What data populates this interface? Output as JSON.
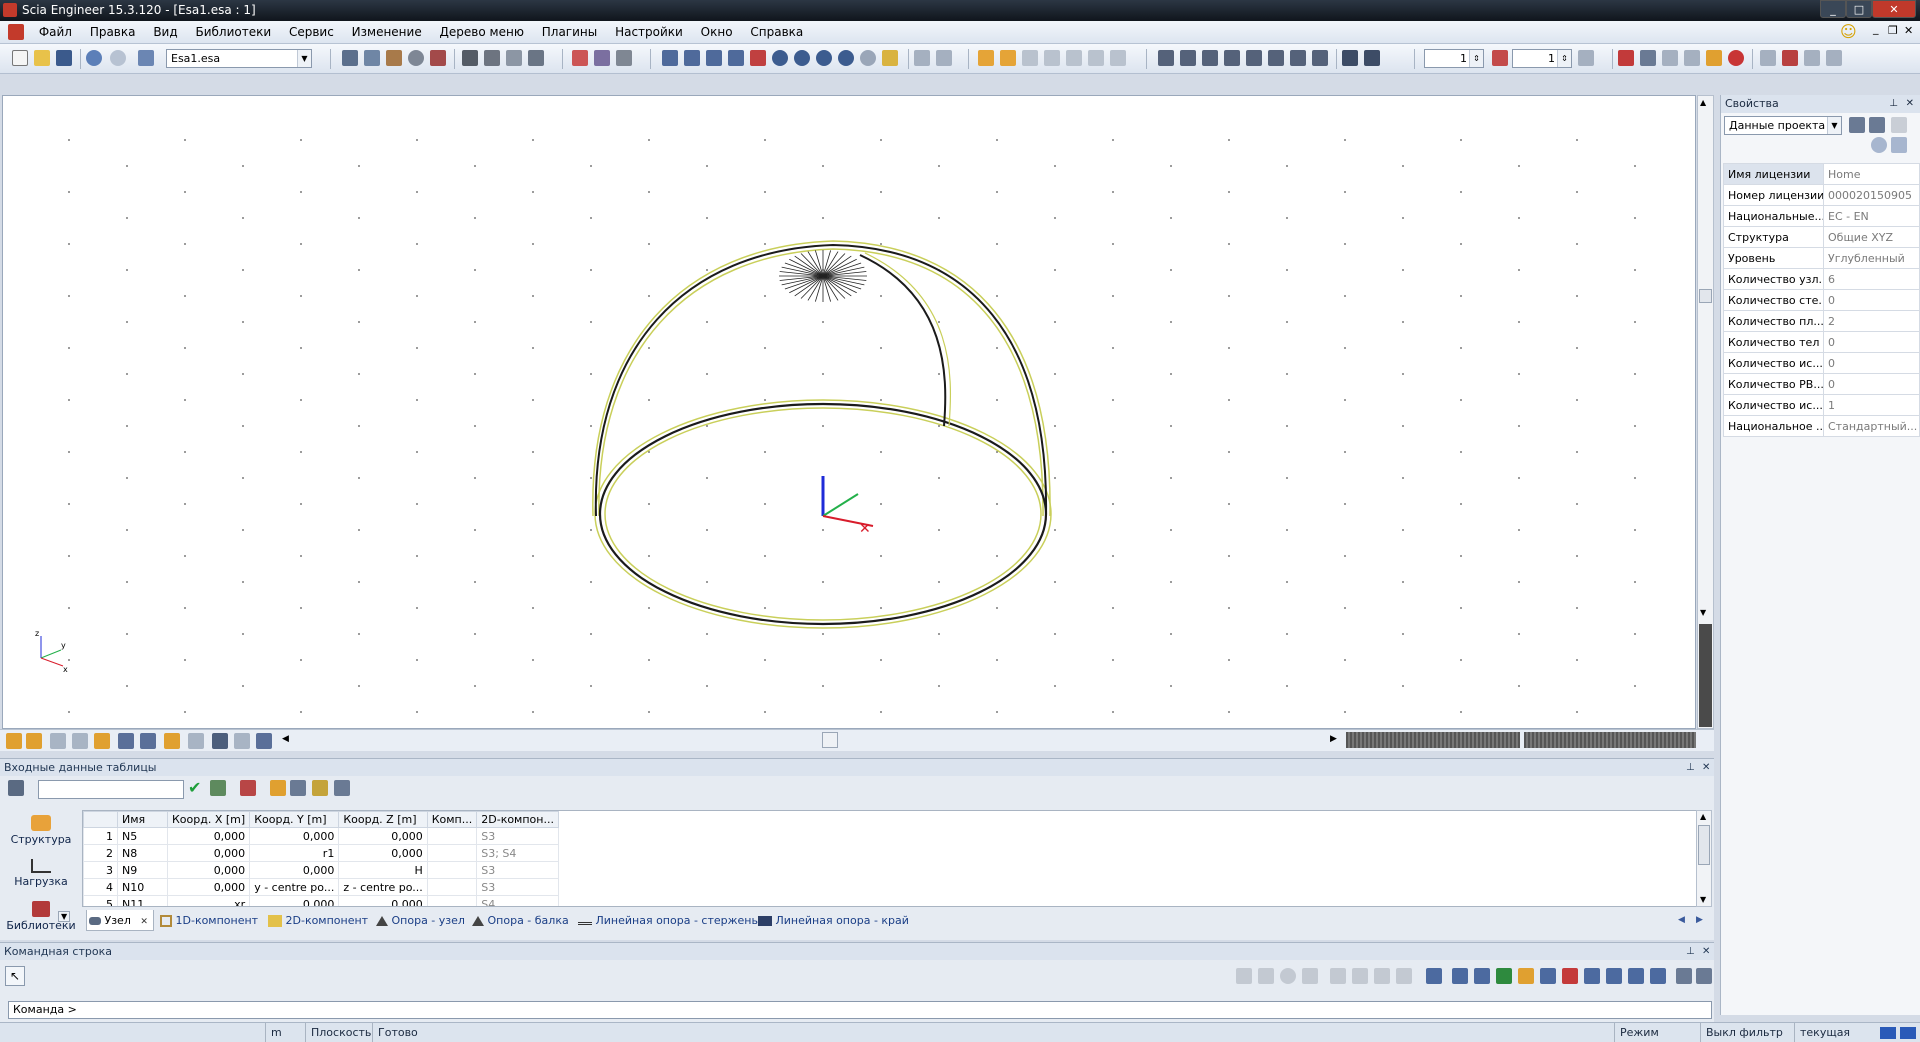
{
  "window": {
    "title": "Scia Engineer 15.3.120 - [Esa1.esa : 1]",
    "buttons": [
      "_",
      "□",
      "✕"
    ]
  },
  "menu": [
    "Файл",
    "Правка",
    "Вид",
    "Библиотеки",
    "Сервис",
    "Изменение",
    "Дерево меню",
    "Плагины",
    "Настройки",
    "Окно",
    "Справка"
  ],
  "toolbar": {
    "file_combo": "Esa1.esa",
    "spin1": "1",
    "spin2": "1"
  },
  "properties": {
    "title": "Свойства",
    "selector": "Данные проекта (",
    "rows": [
      {
        "k": "Имя лицензии",
        "v": "Home"
      },
      {
        "k": "Номер лицензии",
        "v": "000020150905"
      },
      {
        "k": "Национальные...",
        "v": "EC - EN"
      },
      {
        "k": "Структура",
        "v": "Общие XYZ"
      },
      {
        "k": "Уровень",
        "v": "Углубленный"
      },
      {
        "k": "Количество узл...",
        "v": "6"
      },
      {
        "k": "Количество сте...",
        "v": "0"
      },
      {
        "k": "Количество пл...",
        "v": "2"
      },
      {
        "k": "Количество тел :",
        "v": "0"
      },
      {
        "k": "Количество ис...",
        "v": "0"
      },
      {
        "k": "Количество РВ...",
        "v": "0"
      },
      {
        "k": "Количество ис...",
        "v": "1"
      },
      {
        "k": "Национальное ...",
        "v": "Стандартный..."
      }
    ]
  },
  "table_panel": {
    "title": "Входные данные таблицы",
    "side": [
      "Структура",
      "Нагрузка",
      "Библиотеки"
    ],
    "columns": [
      "",
      "Имя",
      "Коорд. X [m]",
      "Коорд. Y [m]",
      "Коорд. Z [m]",
      "Комп...",
      "2D-компон..."
    ],
    "rows": [
      [
        "1",
        "N5",
        "0,000",
        "0,000",
        "0,000",
        "",
        "S3"
      ],
      [
        "2",
        "N8",
        "0,000",
        "r1",
        "0,000",
        "",
        "S3; S4"
      ],
      [
        "3",
        "N9",
        "0,000",
        "0,000",
        "H",
        "",
        "S3"
      ],
      [
        "4",
        "N10",
        "0,000",
        "y - centre po...",
        "z - centre po...",
        "",
        "S3"
      ],
      [
        "5",
        "N11",
        "...xr",
        "0,000",
        "0,000",
        "",
        "S4"
      ]
    ],
    "tabs": [
      "Узел",
      "1D-компонент",
      "2D-компонент",
      "Опора - узел",
      "Опора - балка",
      "Линейная опора - стержень",
      "Линейная опора - край"
    ]
  },
  "command": {
    "title": "Командная строка",
    "prompt": "Команда >"
  },
  "status": {
    "unit": "m",
    "plane": "Плоскость",
    "ready": "Готово",
    "mode": "Режим отслеж",
    "filter": "Выкл фильтр",
    "ucs": "текущая ПСК"
  },
  "axes_labels": {
    "z": "z",
    "y": "y",
    "x": "x"
  },
  "colors": {
    "dome_outer": "#c9cf5a",
    "dome_inner": "#1b1b1b",
    "axis_blue": "#1f2bd8",
    "axis_green": "#23b04a",
    "axis_red": "#d81c2b"
  }
}
